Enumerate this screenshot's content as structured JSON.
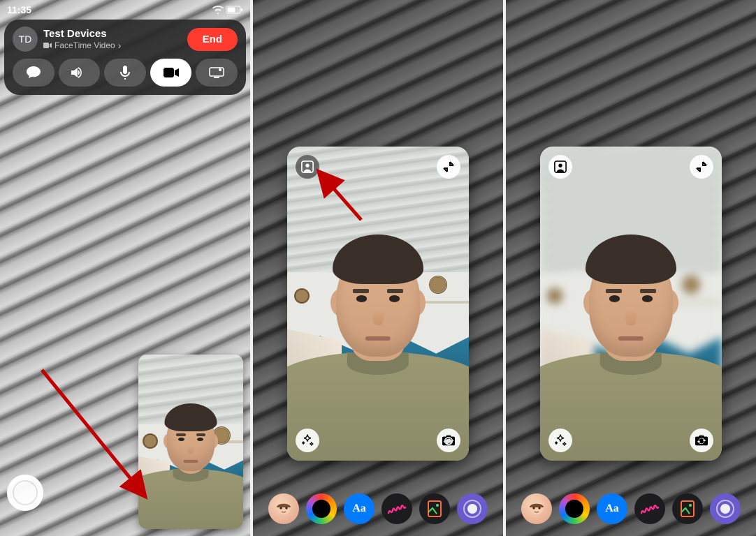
{
  "status_bar": {
    "time": "11:35"
  },
  "call": {
    "avatar_initials": "TD",
    "caller_name": "Test Devices",
    "subtitle": "FaceTime Video",
    "end_button": "End"
  },
  "controls": {
    "message": "message",
    "speaker": "speaker",
    "mute": "mute",
    "camera": "camera",
    "share": "screen-share"
  },
  "effects": {
    "text_label": "Aa"
  },
  "icons": {
    "portrait": "portrait-icon",
    "shrink": "shrink-icon",
    "star_effects": "star-effects-icon",
    "flip_camera": "flip-camera-icon",
    "camera": "camera-icon",
    "chevron": "›"
  },
  "colors": {
    "end_red": "#ff3b30",
    "accent_blue": "#007aff",
    "arrow_red": "#c00000"
  }
}
